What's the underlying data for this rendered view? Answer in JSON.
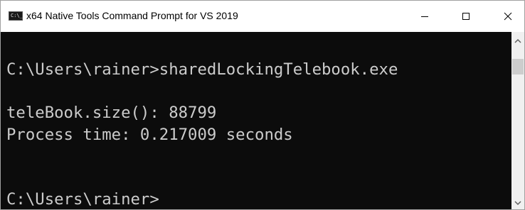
{
  "window": {
    "title": "x64 Native Tools Command Prompt for VS 2019",
    "icon_label": "C:\\_",
    "icon_name": "console-app-icon"
  },
  "controls": {
    "minimize_icon": "minimize-icon",
    "maximize_icon": "maximize-icon",
    "close_icon": "close-icon"
  },
  "console": {
    "lines": [
      "C:\\Users\\rainer>sharedLockingTelebook.exe",
      "",
      "teleBook.size(): 88799",
      "Process time: 0.217009 seconds",
      "",
      "",
      "C:\\Users\\rainer>"
    ],
    "background": "#0c0c0c",
    "foreground": "#cccccc"
  },
  "scrollbar": {
    "up_icon": "chevron-up-icon",
    "down_icon": "chevron-down-icon"
  }
}
